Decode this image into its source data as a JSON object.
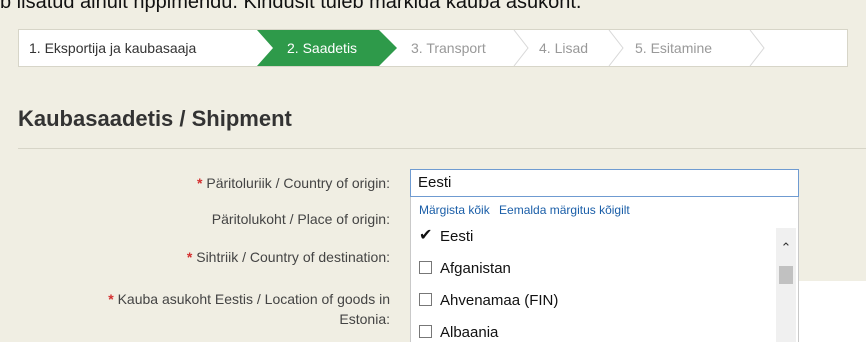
{
  "header_cut_text": "b lisatud ainult nppimendu. Kinduslt tuleb märkida kauba asukoht.",
  "steps": [
    {
      "label": "1. Eksportija ja kaubasaaja",
      "state": "done"
    },
    {
      "label": "2. Saadetis",
      "state": "active"
    },
    {
      "label": "3. Transport",
      "state": "pending"
    },
    {
      "label": "4. Lisad",
      "state": "pending"
    },
    {
      "label": "5. Esitamine",
      "state": "pending"
    }
  ],
  "section_title": "Kaubasaadetis / Shipment",
  "fields": {
    "country_origin": {
      "label": "Päritoluriik / Country of origin:",
      "required": true
    },
    "place_origin": {
      "label": "Päritolukoht / Place of origin:",
      "required": false
    },
    "country_destination": {
      "label": "Sihtriik / Country of destination:",
      "required": true
    },
    "location_line1": "Kauba asukoht Eestis / Location of goods in",
    "location_line2": "Estonia:"
  },
  "required_marker": "*",
  "country_input_value": "Eesti",
  "dropdown": {
    "select_all": "Märgista kõik",
    "deselect_all": "Eemalda märgitus kõigilt",
    "options": [
      {
        "label": "Eesti",
        "checked": true
      },
      {
        "label": "Afganistan",
        "checked": false
      },
      {
        "label": "Ahvenamaa (FIN)",
        "checked": false
      },
      {
        "label": "Albaania",
        "checked": false
      }
    ]
  },
  "colors": {
    "active_step": "#2e9a4a",
    "required": "#d32f2f",
    "link": "#1a5ea8"
  }
}
